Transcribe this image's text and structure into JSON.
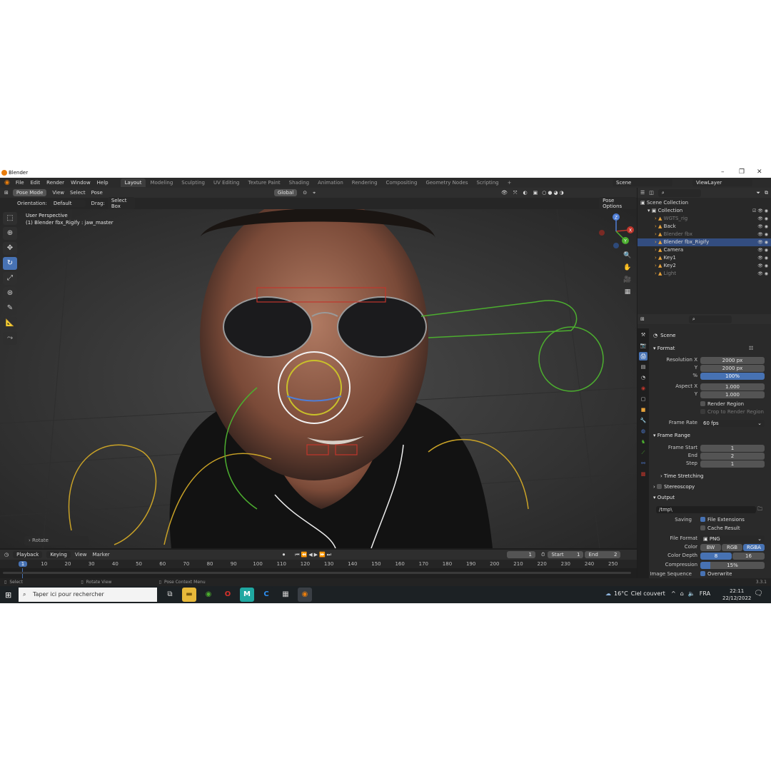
{
  "window": {
    "title": "Blender"
  },
  "menu": [
    "File",
    "Edit",
    "Render",
    "Window",
    "Help"
  ],
  "workspaces": [
    "Layout",
    "Modeling",
    "Sculpting",
    "UV Editing",
    "Texture Paint",
    "Shading",
    "Animation",
    "Rendering",
    "Compositing",
    "Geometry Nodes",
    "Scripting"
  ],
  "scene_name": "Scene",
  "view_layer": "ViewLayer",
  "viewport_header": {
    "mode": "Pose Mode",
    "menus": [
      "View",
      "Select",
      "Pose"
    ],
    "transform": "Global",
    "pose_options": "Pose Options"
  },
  "tool_settings": {
    "orientation_label": "Orientation:",
    "orientation_value": "Default",
    "drag_label": "Drag:",
    "drag_value": "Select Box"
  },
  "viewport": {
    "perspective": "User Perspective",
    "object_info": "(1) Blender fbx_Rigify : jaw_master",
    "last_op": "Rotate",
    "gizmo_axes": [
      "X",
      "Y",
      "Z"
    ]
  },
  "timeline": {
    "menus": [
      "Playback",
      "Keying",
      "View",
      "Marker"
    ],
    "current_frame": "1",
    "start_label": "Start",
    "start": "1",
    "end_label": "End",
    "end": "2",
    "ticks": [
      "1",
      "10",
      "20",
      "30",
      "40",
      "50",
      "60",
      "70",
      "80",
      "90",
      "100",
      "110",
      "120",
      "130",
      "140",
      "150",
      "160",
      "170",
      "180",
      "190",
      "200",
      "210",
      "220",
      "230",
      "240",
      "250"
    ]
  },
  "statusbar": {
    "select": "Select",
    "rotate_view": "Rotate View",
    "context_menu": "Pose Context Menu",
    "version": "3.3.1"
  },
  "outliner": {
    "root": "Scene Collection",
    "collection": "Collection",
    "items": [
      {
        "name": "WGTS_rig",
        "dim": true
      },
      {
        "name": "Back",
        "dim": false
      },
      {
        "name": "Blender fbx",
        "dim": true
      },
      {
        "name": "Blender fbx_Rigify",
        "dim": false,
        "selected": true
      },
      {
        "name": "Camera",
        "dim": false
      },
      {
        "name": "Key1",
        "dim": false
      },
      {
        "name": "Key2",
        "dim": false
      },
      {
        "name": "Light",
        "dim": true
      }
    ]
  },
  "properties": {
    "context": "Scene",
    "format_header": "Format",
    "resolution_x_label": "Resolution X",
    "resolution_x": "2000 px",
    "y_label": "Y",
    "resolution_y": "2000 px",
    "percent_label": "%",
    "percent": "100%",
    "aspect_x_label": "Aspect X",
    "aspect_x": "1.000",
    "aspect_y": "1.000",
    "render_region": "Render Region",
    "crop_region": "Crop to Render Region",
    "frame_rate_label": "Frame Rate",
    "frame_rate": "60 fps",
    "frame_range_header": "Frame Range",
    "frame_start_label": "Frame Start",
    "frame_start": "1",
    "end_label": "End",
    "frame_end": "2",
    "step_label": "Step",
    "frame_step": "1",
    "time_stretching": "Time Stretching",
    "stereoscopy": "Stereoscopy",
    "output_header": "Output",
    "output_path": "/tmp\\",
    "saving_label": "Saving",
    "file_extensions": "File Extensions",
    "cache_result": "Cache Result",
    "file_format_label": "File Format",
    "file_format": "PNG",
    "color_label": "Color",
    "color_options": [
      "BW",
      "RGB",
      "RGBA"
    ],
    "color_depth_label": "Color Depth",
    "color_depth_options": [
      "8",
      "16"
    ],
    "compression_label": "Compression",
    "compression": "15%",
    "compression_fraction": 0.15,
    "image_sequence_label": "Image Sequence",
    "overwrite": "Overwrite"
  },
  "taskbar": {
    "search_placeholder": "Taper ici pour rechercher",
    "weather_temp": "16°C",
    "weather_text": "Ciel couvert",
    "lang": "FRA",
    "time": "22:11",
    "date": "22/12/2022"
  },
  "colors": {
    "accent": "#4772b3",
    "selected_row": "#334d80",
    "blender_orange": "#e87d0d"
  }
}
